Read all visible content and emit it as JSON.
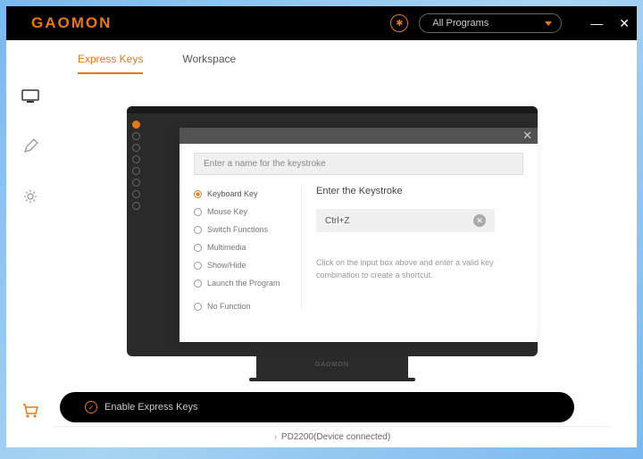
{
  "logo": "GAOMON",
  "dropdown": "All Programs",
  "tabs": {
    "express": "Express Keys",
    "workspace": "Workspace"
  },
  "popup": {
    "name_placeholder": "Enter a name for the keystroke",
    "categories": {
      "keyboard": "Keyboard Key",
      "mouse": "Mouse Key",
      "switch": "Switch Functions",
      "multimedia": "Multimedia",
      "showhide": "Show/Hide",
      "launch": "Launch the Program",
      "nofunc": "No Function"
    },
    "ks_title": "Enter the Keystroke",
    "ks_value": "Ctrl+Z",
    "ks_hint": "Click on the input box above and  enter a valid key combination to create a shortcut."
  },
  "stand_logo": "GAOMON",
  "enable_label": "Enable Express Keys",
  "status": "PD2200(Device connected)"
}
